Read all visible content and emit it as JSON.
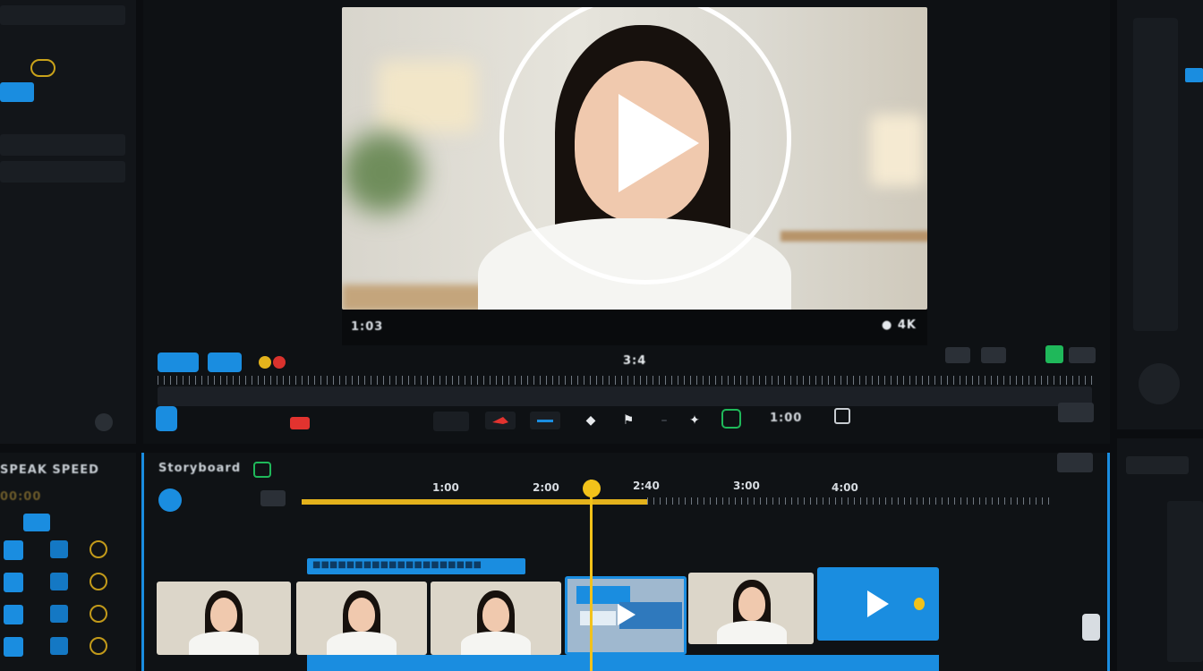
{
  "preview": {
    "timecode_left": "1:03",
    "badge_right": "● 4K",
    "play_icon": "play-icon"
  },
  "transport": {
    "time_center": "3:4",
    "chips": [
      "■■■",
      "■■■"
    ],
    "marks_icon": "flag-icon",
    "counter": "1:00",
    "right_label": "■■■"
  },
  "timeline": {
    "title": "Storyboard",
    "ruler_labels": [
      "1:00",
      "2:00",
      "2:40",
      "3:00",
      "4:00"
    ],
    "clip_strip_label": "■■■■■■■■■■■■■■■■■■■■",
    "colors": {
      "accent": "#1a8de0",
      "playhead": "#f2c21a",
      "record": "#e2332f",
      "green": "#1fb85a"
    }
  },
  "sidebar": {
    "header": "SPEAK SPEED",
    "sub": "00:00"
  }
}
